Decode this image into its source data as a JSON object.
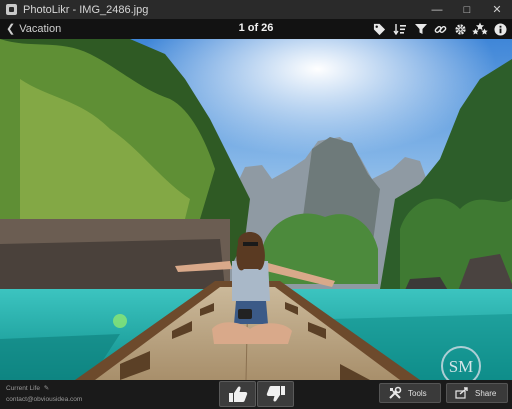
{
  "window": {
    "title": "PhotoLikr - IMG_2486.jpg"
  },
  "toolbar": {
    "back_label": "Vacation",
    "counter": "1 of 26",
    "icons": [
      "tag-icon",
      "sort-icon",
      "filter-icon",
      "link-icon",
      "gear-icon",
      "rating-stars-icon",
      "info-icon"
    ]
  },
  "footer": {
    "caption": "Current Life",
    "contact": "contact@obviousidea.com",
    "tools_label": "Tools",
    "share_label": "Share"
  },
  "watermark": {
    "text": "SM"
  },
  "colors": {
    "background": "#1b1b1b",
    "toolbar": "#121212",
    "water": "#1fb0aa"
  }
}
